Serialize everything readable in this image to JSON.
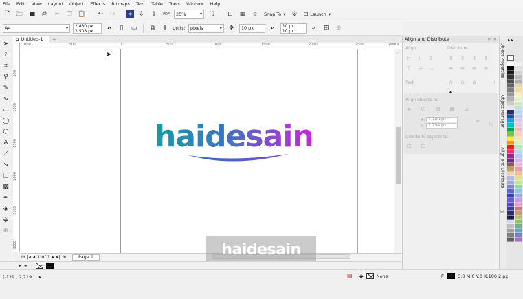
{
  "menu": [
    "File",
    "Edit",
    "View",
    "Layout",
    "Object",
    "Effects",
    "Bitmaps",
    "Text",
    "Table",
    "Tools",
    "Window",
    "Help"
  ],
  "toolbar": {
    "zoom_value": "25%",
    "snap_label": "Snap To",
    "launch_label": "Launch",
    "icons": [
      "new-icon",
      "open-icon",
      "save-icon",
      "print-icon",
      "cut-icon",
      "copy-icon",
      "paste-icon",
      "undo-icon",
      "redo-icon",
      "search-icon",
      "import-icon",
      "export-icon",
      "pdf-icon",
      "fullscreen-icon",
      "rulers-icon",
      "grid-icon",
      "guidelines-icon",
      "settings-icon",
      "launch-icon"
    ]
  },
  "property_bar": {
    "page_size": "A4",
    "width": "2,480 px",
    "height": "3,508 px",
    "units_label": "Units:",
    "units_value": "pixels",
    "nudge_value": "10 px",
    "dup_x": "10 px",
    "dup_y": "10 px"
  },
  "document": {
    "tab_title": "Untitled-1",
    "ruler_unit": "pixels",
    "ruler_h_ticks": [
      "1000",
      "500",
      "0",
      "500",
      "1000",
      "1500",
      "2000",
      "2500"
    ],
    "ruler_v_ticks": [
      "500",
      "1000",
      "1500",
      "2000",
      "2500",
      "3000"
    ],
    "logo_text": "haidesain",
    "page_counter": "1 of 1",
    "page_tab": "Page 1",
    "watermark": "haidesain"
  },
  "status": {
    "coordinates": "(-129 , 2,719 )",
    "fill_label": "None",
    "outline_label": "C:0 M:0 Y:0 K:100  2 px"
  },
  "docker": {
    "title": "Align and Distribute",
    "sections": {
      "align": "Align",
      "distribute": "Distribute",
      "text": "Text",
      "align_objects_to": "Align objects to:",
      "distribute_objects_to": "Distribute objects to:"
    },
    "coord_x": "1,240 px",
    "coord_y": "1,754 px",
    "vertical_tabs": [
      "Object Properties",
      "Object Manager",
      "Align and Distribute"
    ]
  },
  "palette": {
    "col1": [
      "#ffffff",
      "#000000",
      "#1a1a1a",
      "#333333",
      "#4d4d4d",
      "#666666",
      "#808080",
      "#999999",
      "#b3b3b3",
      "#cccccc",
      "#e6e6e6",
      "#2b2b6b",
      "#1f4e9c",
      "#00a2e8",
      "#00c0c0",
      "#00a651",
      "#7cc242",
      "#fff200",
      "#f7941d",
      "#ed1c24",
      "#ee2a7b",
      "#92278f",
      "#662d91",
      "#8c6239",
      "#c69c6d",
      "#f5d0a9",
      "#b5b5e8",
      "#9fa8da",
      "#7986cb",
      "#5c6bc0",
      "#3949ab",
      "#6a5acd",
      "#4b4bad",
      "#3c3c8c",
      "#2d2d6e",
      "#1e1e50",
      "#d9d9f3",
      "#c0c0c0",
      "#a0a0a0",
      "#808080",
      "#606060"
    ],
    "col2": [
      "#f0f0f0",
      "#e0e0e0",
      "#d0d0d0",
      "#c0c0c0",
      "#b0b0b0",
      "#e8d8b0",
      "#f0e0a0",
      "#f8f0c0",
      "#e8f0c8",
      "#d0e8c0",
      "#c0e0d8",
      "#b8d8f0",
      "#c8c8f0",
      "#e0c8f0",
      "#f0c8e0",
      "#f0c0c0",
      "#f8d0b0",
      "#f0e8b8",
      "#d8f0b0",
      "#b8e8c8",
      "#b0e0e8",
      "#b8c8f0",
      "#d0b8f0",
      "#f0b8d8",
      "#e8a0a0",
      "#f0c090",
      "#e8e090",
      "#c0e890",
      "#90d8b0",
      "#90c8e8",
      "#a0a8e8",
      "#c0a0e8",
      "#e8a0c8",
      "#c08080",
      "#c0a070",
      "#c0c070",
      "#90c070",
      "#70b090",
      "#70a0c0",
      "#8080c0",
      "#a070c0"
    ]
  }
}
